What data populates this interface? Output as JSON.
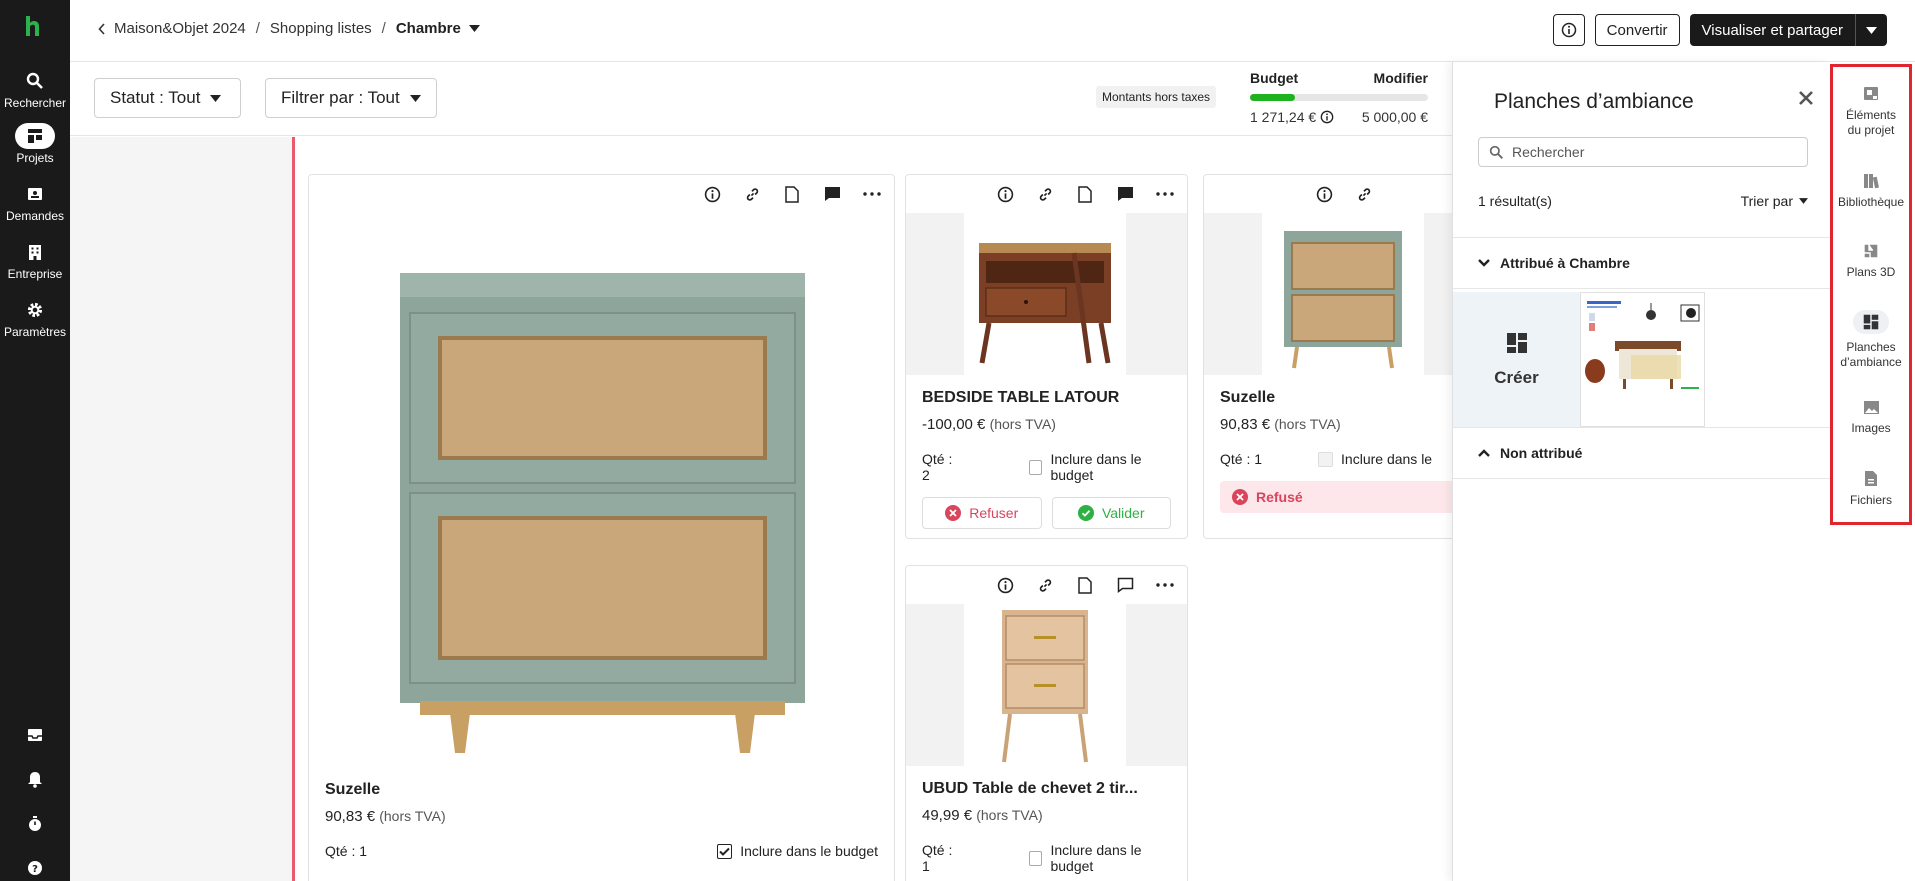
{
  "nav": {
    "items": [
      {
        "label": "Rechercher",
        "icon": "search-icon"
      },
      {
        "label": "Projets",
        "icon": "projects-icon"
      },
      {
        "label": "Demandes",
        "icon": "requests-icon"
      },
      {
        "label": "Entreprise",
        "icon": "building-icon"
      },
      {
        "label": "Paramètres",
        "icon": "gear-icon"
      }
    ]
  },
  "header": {
    "breadcrumb": [
      "Maison&Objet 2024",
      "Shopping listes",
      "Chambre"
    ],
    "convert_label": "Convertir",
    "share_label": "Visualiser et partager"
  },
  "filters": {
    "status_label": "Statut : Tout",
    "filter_label": "Filtrer par : Tout",
    "ht_label": "Montants hors taxes"
  },
  "budget": {
    "title": "Budget",
    "edit_label": "Modifier",
    "spent": "1 271,24 €",
    "total": "5 000,00 €",
    "fill_fraction": 0.254
  },
  "cards": [
    {
      "title": "Suzelle",
      "price": "90,83 €",
      "tax": "(hors TVA)",
      "qty": "Qté : 1",
      "include_label": "Inclure dans le budget"
    },
    {
      "title": "BEDSIDE TABLE LATOUR",
      "price": "-100,00 €",
      "tax": "(hors TVA)",
      "qty": "Qté : 2",
      "include_label": "Inclure dans le budget",
      "refuse_label": "Refuser",
      "validate_label": "Valider"
    },
    {
      "title": "Suzelle",
      "price": "90,83 €",
      "tax": "(hors TVA)",
      "qty": "Qté : 1",
      "include_label": "Inclure dans le",
      "refused_label": "Refusé"
    },
    {
      "title": "UBUD Table de chevet 2 tir...",
      "price": "49,99 €",
      "tax": "(hors TVA)",
      "qty": "Qté : 1",
      "include_label": "Inclure dans le budget"
    }
  ],
  "panel": {
    "title": "Planches d’ambiance",
    "search_placeholder": "Rechercher",
    "count": "1 résultat(s)",
    "sort_label": "Trier par",
    "section_assigned": "Attribué à Chambre",
    "section_unassigned": "Non attribué",
    "create_label": "Créer"
  },
  "rail": {
    "items": [
      {
        "line1": "Éléments",
        "line2": "du projet"
      },
      {
        "line1": "Bibliothèque",
        "line2": ""
      },
      {
        "line1": "Plans 3D",
        "line2": ""
      },
      {
        "line1": "Planches",
        "line2": "d’ambiance"
      },
      {
        "line1": "Images",
        "line2": ""
      },
      {
        "line1": "Fichiers",
        "line2": ""
      }
    ]
  },
  "colors": {
    "brand_green": "#2bb24c",
    "budget_green": "#1eb31e",
    "refuse_red": "#d8455c",
    "validate_green": "#2db143",
    "highlight_red": "#e0262f"
  }
}
